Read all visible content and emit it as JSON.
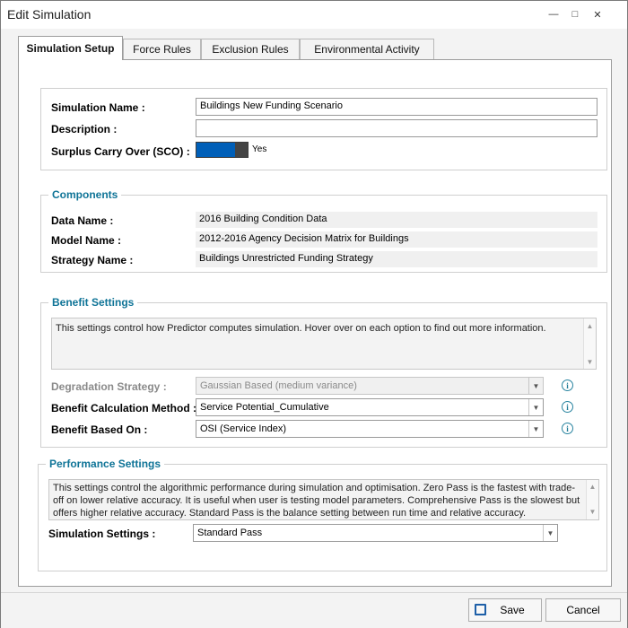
{
  "window": {
    "title": "Edit Simulation"
  },
  "tabs": [
    {
      "label": "Simulation Setup"
    },
    {
      "label": "Force Rules"
    },
    {
      "label": "Exclusion Rules"
    },
    {
      "label": "Environmental Activity"
    }
  ],
  "setup": {
    "simulation_name_label": "Simulation Name :",
    "simulation_name_value": "Buildings New Funding Scenario",
    "description_label": "Description :",
    "description_value": "",
    "sco_label": "Surplus Carry Over (SCO) :",
    "sco_state": "Yes"
  },
  "components": {
    "title": "Components",
    "data_name_label": "Data Name :",
    "data_name_value": "2016 Building Condition Data",
    "model_name_label": "Model Name :",
    "model_name_value": "2012-2016 Agency Decision Matrix for Buildings",
    "strategy_name_label": "Strategy Name :",
    "strategy_name_value": "Buildings Unrestricted Funding Strategy"
  },
  "benefit": {
    "title": "Benefit Settings",
    "description": "This settings control how Predictor computes simulation. Hover over on each option to find out more information.",
    "degradation_label": "Degradation Strategy :",
    "degradation_value": "Gaussian Based (medium variance)",
    "calc_method_label": "Benefit Calculation Method :",
    "calc_method_value": "Service Potential_Cumulative",
    "based_on_label": "Benefit Based On :",
    "based_on_value": "OSI (Service Index)"
  },
  "performance": {
    "title": "Performance Settings",
    "description": "This settings control the algorithmic performance during simulation and optimisation. Zero Pass is the fastest with trade-off on lower relative accuracy. It is useful when user is testing model parameters. Comprehensive Pass is the slowest but offers higher relative accuracy. Standard Pass is the balance setting between run time and relative accuracy.",
    "sim_settings_label": "Simulation Settings :",
    "sim_settings_value": "Standard Pass"
  },
  "footer": {
    "save_label": "Save",
    "cancel_label": "Cancel"
  },
  "colors": {
    "accent": "#0f7497",
    "toggle": "#005fb8"
  }
}
